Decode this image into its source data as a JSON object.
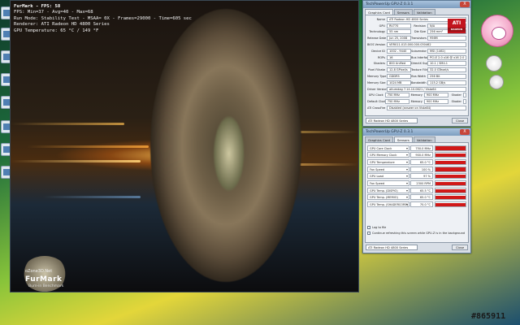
{
  "furmark": {
    "osd": {
      "title": "FurMark - FPS: 58",
      "line1": "FPS: Min=37 - Avg=40 - Max=68",
      "line2": "Run Mode: Stability Test - MSAA= 0X - Frames=29000 - Time=605 sec",
      "line3": "Renderer: ATI Radeon HD 4800 Series",
      "line4": "GPU Temperature: 65 °C / 149 °F"
    },
    "logo_top": "oZone3D.Net",
    "logo_name": "FurMark",
    "logo_sub": "Burn-in Benchmark"
  },
  "gpuz_card": {
    "title": "TechPowerUp GPU-Z 0.3.1",
    "close": "X",
    "tabs": [
      "Graphics Card",
      "Sensors",
      "Validation"
    ],
    "ati_logo": "ATI",
    "ati_logo_sub": "RADEON",
    "rows": [
      {
        "label": "Name",
        "value": "ATI Radeon HD 4800 Series"
      },
      {
        "label": "GPU",
        "value": "RV770",
        "sublabel": "Revision",
        "subvalue": "N/A"
      },
      {
        "label": "Technology",
        "value": "55 nm",
        "sublabel": "Die Size",
        "subvalue": "256 mm²"
      },
      {
        "label": "Release Date",
        "value": "Jun 25, 2008",
        "sublabel": "Transistors",
        "subvalue": "956M"
      },
      {
        "label": "BIOS Version",
        "value": "VER011.013.000.000.030462"
      },
      {
        "label": "Device ID",
        "value": "1002 - 9440",
        "sublabel": "Subvendor",
        "subvalue": "MSI (1462)"
      },
      {
        "label": "ROPs",
        "value": "16",
        "sublabel": "Bus Interface",
        "subvalue": "PCI-E 2.0 x16 @ x16 2.0"
      },
      {
        "label": "Shaders",
        "value": "800 Unified",
        "sublabel": "DirectX Support",
        "subvalue": "10.1 / SM4.1"
      },
      {
        "label": "Pixel Fillrate",
        "value": "12.8 GPixel/s",
        "sublabel": "Texture Fillrate",
        "subvalue": "32.0 GTexel/s"
      },
      {
        "label": "Memory Type",
        "value": "GDDR5",
        "sublabel": "Bus Width",
        "subvalue": "256 Bit"
      },
      {
        "label": "Memory Size",
        "value": "1024 MB",
        "sublabel": "Bandwidth",
        "subvalue": "115.2 GB/s"
      },
      {
        "label": "Driver Version",
        "value": "atiumdag 7.14.10.0621 / Vista64"
      },
      {
        "label": "GPU Clock",
        "value": "750 MHz",
        "sublabel": "Memory",
        "subvalue": "900 MHz",
        "sublabel2": "Shader",
        "subvalue2": ""
      },
      {
        "label": "Default Clock",
        "value": "750 MHz",
        "sublabel": "Memory",
        "subvalue": "900 MHz",
        "sublabel2": "Shader",
        "subvalue2": ""
      },
      {
        "label": "ATI CrossFire",
        "value": "Disabled (answer on Vista64)"
      }
    ],
    "select_value": "ATI Radeon HD 4800 Series",
    "close_button": "Close"
  },
  "gpuz_sensors": {
    "title": "TechPowerUp GPU-Z 0.3.1",
    "close": "X",
    "tabs": [
      "Graphics Card",
      "Sensors",
      "Validation"
    ],
    "sensors": [
      {
        "name": "GPU Core Clock",
        "value": "750.0 MHz",
        "level": 0.85
      },
      {
        "name": "GPU Memory Clock",
        "value": "900.0 MHz",
        "level": 0.85
      },
      {
        "name": "GPU Temperature",
        "value": "65.0 °C",
        "level": 0.8
      },
      {
        "name": "Fan Speed",
        "value": "100 %",
        "level": 1.0
      },
      {
        "name": "GPU Load",
        "value": "97 %",
        "level": 0.95
      },
      {
        "name": "Fan Speed",
        "value": "2300 RPM",
        "level": 0.8
      },
      {
        "name": "GPU Temp. (DISPIO)",
        "value": "65.5 °C",
        "level": 0.8
      },
      {
        "name": "GPU Temp. (MEMIO)",
        "value": "65.0 °C",
        "level": 0.8
      },
      {
        "name": "GPU Temp. (SHADERCORE)",
        "value": "70.0 °C",
        "level": 0.8
      }
    ],
    "log_label": "Log to file",
    "refresh_label": "Continue refreshing this screen while GPU-Z is in the background",
    "select_value": "ATI Radeon HD 4800 Series",
    "close_button": "Close"
  },
  "watermark": "#865911"
}
